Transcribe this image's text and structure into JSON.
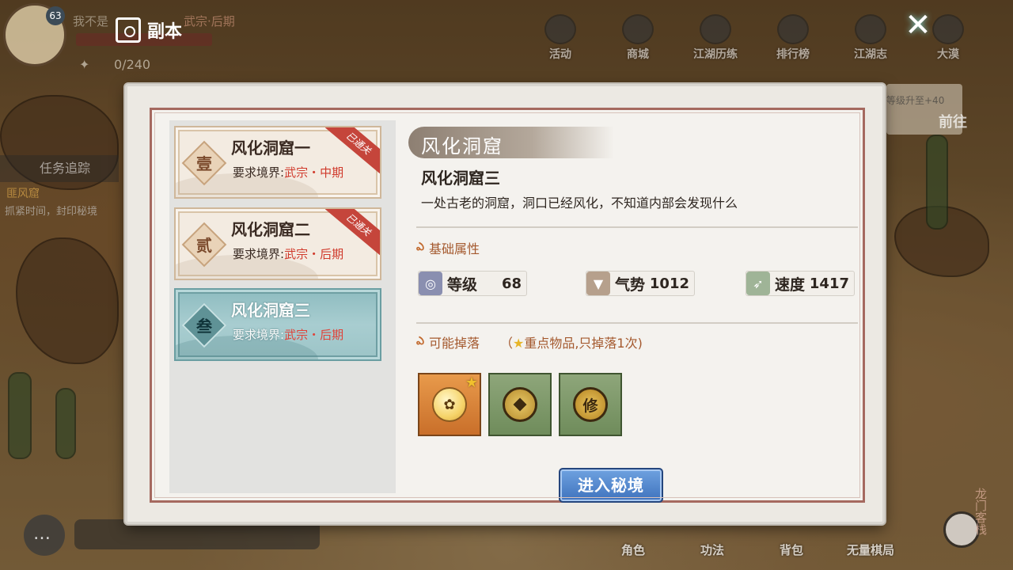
{
  "header": {
    "avatar_level": "63",
    "player_name": "我不是",
    "player_realm": "武宗·后期",
    "stamina": "0/240",
    "page_title": "副本"
  },
  "top_nav": [
    {
      "label": "活动",
      "icon": "activity-icon"
    },
    {
      "label": "商城",
      "icon": "shop-icon"
    },
    {
      "label": "江湖历练",
      "icon": "training-icon"
    },
    {
      "label": "排行榜",
      "icon": "ranking-icon"
    },
    {
      "label": "江湖志",
      "icon": "chronicle-icon"
    },
    {
      "label": "大漠",
      "icon": "desert-icon"
    }
  ],
  "quest": {
    "track_label": "任务追踪",
    "name": "匪风窟",
    "desc": "抓紧时间，封印秘境"
  },
  "side_banner": {
    "text": "等级升至+40",
    "go_label": "前往"
  },
  "bottom_nav": [
    {
      "label": "角色"
    },
    {
      "label": "功法"
    },
    {
      "label": "背包"
    },
    {
      "label": "无量棋局"
    }
  ],
  "vertical_label": "龙门客栈",
  "dungeons": [
    {
      "badge": "壹",
      "title": "风化洞窟一",
      "req_prefix": "要求境界:",
      "req_realm": "武宗・中期",
      "cleared": true,
      "cleared_label": "已通关",
      "active": false
    },
    {
      "badge": "贰",
      "title": "风化洞窟二",
      "req_prefix": "要求境界:",
      "req_realm": "武宗・后期",
      "cleared": true,
      "cleared_label": "已通关",
      "active": false
    },
    {
      "badge": "叁",
      "title": "风化洞窟三",
      "req_prefix": "要求境界:",
      "req_realm": "武宗・后期",
      "cleared": false,
      "active": true
    }
  ],
  "detail": {
    "title": "风化洞窟",
    "subtitle": "风化洞窟三",
    "description": "一处古老的洞窟，洞口已经风化，不知道内部会发现什么",
    "attr_label": "基础属性",
    "stats": [
      {
        "name": "等级",
        "value": "68",
        "icon": "level-icon",
        "color": "#8a8fb0"
      },
      {
        "name": "气势",
        "value": "1012",
        "icon": "momentum-icon",
        "color": "#b6a08c"
      },
      {
        "name": "速度",
        "value": "1417",
        "icon": "speed-icon",
        "color": "#9fb497"
      }
    ],
    "drop_label": "可能掉落",
    "drop_note_prefix": "（",
    "drop_note_text": "重点物品,只掉落1次)",
    "drops": [
      {
        "icon": "peach-icon",
        "bg": "orange",
        "key_item": true
      },
      {
        "icon": "coin-icon",
        "bg": "green",
        "key_item": false
      },
      {
        "icon": "cultivation-token-icon",
        "bg": "green",
        "key_item": false,
        "glyph": "修"
      }
    ],
    "enter_label": "进入秘境"
  },
  "colors": {
    "frame": "#a5695f",
    "realm_text": "#d03a2c",
    "active_card": "#8ebcc0",
    "enter_button": "#3e72bd"
  }
}
